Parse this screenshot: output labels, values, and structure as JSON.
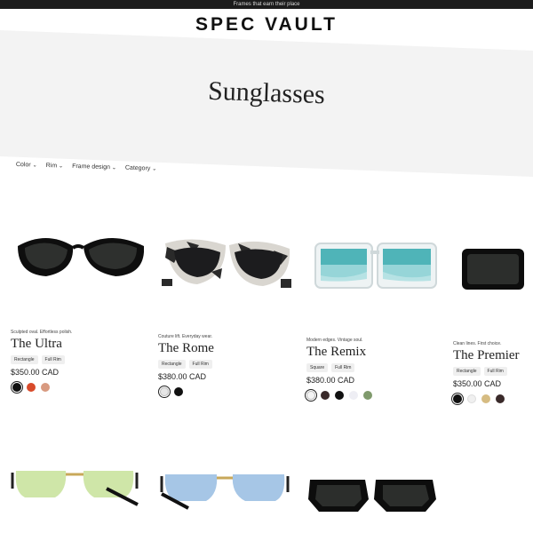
{
  "announcement": "Frames that earn their place",
  "brand": "SPEC VAULT",
  "hero_title": "Sunglasses",
  "filters": [
    "Color",
    "Rim",
    "Frame design",
    "Category"
  ],
  "products": [
    {
      "tagline": "Sculpted oval. Effortless polish.",
      "name": "The Ultra",
      "chips": [
        "Rectangle",
        "Full Rim"
      ],
      "price": "$350.00 CAD",
      "swatches": [
        "#111111",
        "#d84a2a",
        "#d89a80"
      ]
    },
    {
      "tagline": "Couture lift. Everyday wear.",
      "name": "The Rome",
      "chips": [
        "Rectangle",
        "Full Rim"
      ],
      "price": "$380.00 CAD",
      "swatches": [
        "#e6e6e6",
        "#111111"
      ]
    },
    {
      "tagline": "Modern edges. Vintage soul.",
      "name": "The Remix",
      "chips": [
        "Square",
        "Full Rim"
      ],
      "price": "$380.00 CAD",
      "swatches": [
        "#f4f4f4",
        "#3a2a2a",
        "#111111",
        "#eeeef4",
        "#7f9a6c"
      ]
    },
    {
      "tagline": "Clean lines. First choice.",
      "name": "The Premier",
      "chips": [
        "Rectangle",
        "Full Rim"
      ],
      "price": "$350.00 CAD",
      "swatches": [
        "#111111",
        "#f0f0f0",
        "#d6bc82",
        "#3a2a2a"
      ]
    }
  ]
}
